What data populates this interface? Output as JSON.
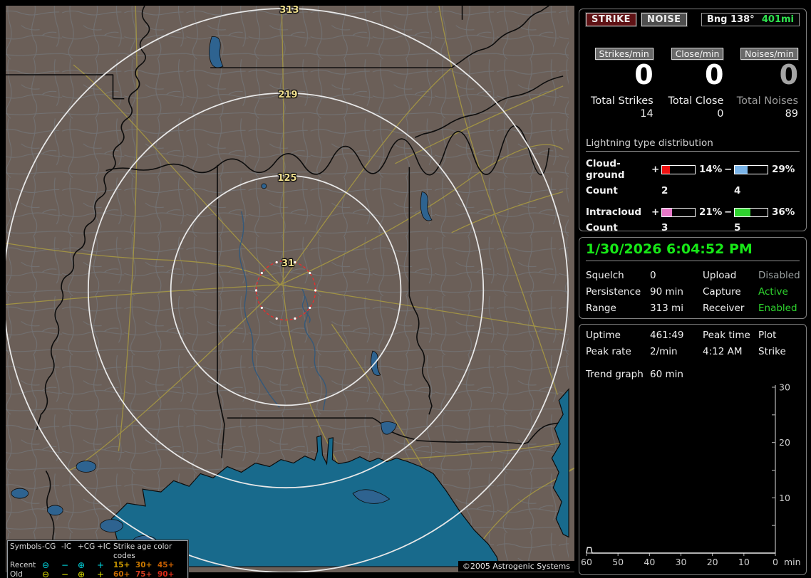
{
  "map": {
    "ring_labels": {
      "r313": "313",
      "r219": "219",
      "r125": "125",
      "r31": "31"
    },
    "copyright": "©2005 Astrogenic Systems",
    "legend": {
      "symbols_header": "Symbols",
      "type_headers": [
        "-CG",
        "-IC",
        "+CG",
        "+IC"
      ],
      "age_header": "Strike age color codes",
      "recent_label": "Recent",
      "old_label": "Old",
      "recent_color": "#00dde6",
      "old_color": "#e6e600",
      "sym_circle_minus": "⊖",
      "sym_minus": "−",
      "sym_circle_plus": "⊕",
      "sym_plus": "+",
      "ages_recent": [
        {
          "label": "15+",
          "color": "#d09c00"
        },
        {
          "label": "30+",
          "color": "#cc7a00"
        },
        {
          "label": "45+",
          "color": "#c85f00"
        }
      ],
      "ages_old": [
        {
          "label": "60+",
          "color": "#c66a00"
        },
        {
          "label": "75+",
          "color": "#d13d20"
        },
        {
          "label": "90+",
          "color": "#dc2a18"
        }
      ]
    },
    "colors": {
      "land": "#6b5f58",
      "water": "#186a8c",
      "road": "#a39543",
      "ring": "#e8e8e8",
      "range_ring_red": "#e03030",
      "label_yellow": "#f0df8e",
      "clock_green": "#17e817",
      "dist_green": "#2ee24e"
    }
  },
  "toolbar": {
    "strike": "STRIKE",
    "noise": "NOISE",
    "bearing": "Bng 138°",
    "distance": "401mi"
  },
  "counters": {
    "cols": [
      {
        "badge": "Strikes/min",
        "rate": "0",
        "total_label": "Total Strikes",
        "total": "14"
      },
      {
        "badge": "Close/min",
        "rate": "0",
        "total_label": "Total Close",
        "total": "0"
      },
      {
        "badge": "Noises/min",
        "rate": "0",
        "total_label": "Total Noises",
        "total": "89"
      }
    ]
  },
  "distribution": {
    "title": "Lightning type distribution",
    "count_label": "Count",
    "plus_sign": "+",
    "minus_sign": "−",
    "rows": [
      {
        "label": "Cloud-ground",
        "plus_pct": "14%",
        "plus_fill": "23%",
        "plus_color": "#ee1111",
        "plus_count": "2",
        "minus_pct": "29%",
        "minus_fill": "40%",
        "minus_color": "#7ab4e8",
        "minus_count": "4"
      },
      {
        "label": "Intracloud",
        "plus_pct": "21%",
        "plus_fill": "31%",
        "plus_color": "#e878c8",
        "plus_count": "3",
        "minus_pct": "36%",
        "minus_fill": "48%",
        "minus_color": "#2ed32e",
        "minus_count": "5"
      }
    ]
  },
  "clock": {
    "datetime": "1/30/2026 6:04:52 PM"
  },
  "settings": {
    "rows": [
      {
        "l1": "Squelch",
        "v1": "0",
        "l2": "Upload",
        "v2": "Disabled",
        "v2_color": "#9aa0a0"
      },
      {
        "l1": "Persistence",
        "v1": "90 min",
        "l2": "Capture",
        "v2": "Active",
        "v2_color": "#2ed32e"
      },
      {
        "l1": "Range",
        "v1": "313 mi",
        "l2": "Receiver",
        "v2": "Enabled",
        "v2_color": "#2ed32e"
      }
    ]
  },
  "status": {
    "rows": [
      {
        "l1": "Uptime",
        "v1": "461:49",
        "l2": "Peak time",
        "v2": "Plot"
      },
      {
        "l1": "Peak rate",
        "v1": "2/min",
        "l2": "4:12 AM",
        "v2": "Strike"
      }
    ],
    "trend_label": "Trend graph",
    "trend_value": "60 min"
  },
  "chart_data": {
    "type": "line",
    "title": "Strike rate trend (last 60 min)",
    "x_ticks": [
      60,
      50,
      40,
      30,
      20,
      10,
      0
    ],
    "x_unit": "min",
    "y_ticks": [
      10,
      20,
      30
    ],
    "y_minor_step": 5,
    "ylim": [
      0,
      30
    ],
    "xlim_minutes_ago": [
      60,
      0
    ],
    "grid": false,
    "axis_color": "#b9b9b9",
    "label_color": "#cfcfcf",
    "series": [
      {
        "name": "Strike",
        "color": "#ffffff",
        "points": [
          [
            60,
            0
          ],
          [
            59.7,
            1
          ],
          [
            58.6,
            1
          ],
          [
            58.2,
            0
          ],
          [
            0,
            0
          ]
        ]
      }
    ]
  }
}
